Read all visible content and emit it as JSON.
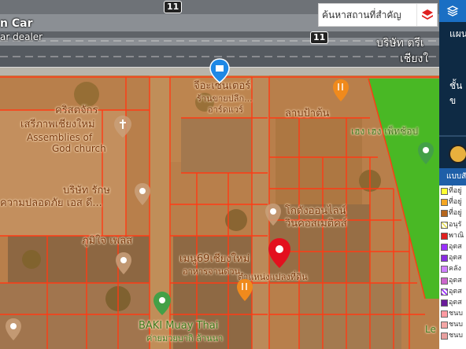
{
  "search": {
    "placeholder": "ค้นหาสถานที่สำคัญ"
  },
  "sidebar": {
    "menu_1": "แผน",
    "menu_2": "ชั้นข"
  },
  "legend": {
    "header": "แบบสัญ",
    "items": [
      {
        "label": "ที่อยู่",
        "color": "#ffff33"
      },
      {
        "label": "ที่อยู่",
        "color": "#f5a623"
      },
      {
        "label": "ที่อยู่",
        "color": "#b5651d"
      },
      {
        "label": "อนุรั",
        "color": "#e8e060",
        "hatched": true
      },
      {
        "label": "พาณิ",
        "color": "#e02020"
      },
      {
        "label": "อุตส",
        "color": "#9b30ff"
      },
      {
        "label": "อุตส",
        "color": "#8a2be2"
      },
      {
        "label": "คลัง",
        "color": "#d080ff"
      },
      {
        "label": "อุตส",
        "color": "#cc66cc"
      },
      {
        "label": "อุตส",
        "color": "#9b30ff",
        "hatched": true
      },
      {
        "label": "อุตส",
        "color": "#6a1b9a"
      },
      {
        "label": "ชนบ",
        "color": "#ff9aa2"
      },
      {
        "label": "ชนบ",
        "color": "#f4a6a6"
      },
      {
        "label": "ชนบ",
        "color": "#e8a0a0"
      }
    ]
  },
  "map": {
    "road_labels": {
      "car_dealer_1": "n Car",
      "car_dealer_2": "ar dealer",
      "company_top_1": "บริษัท ตรีเ",
      "company_top_2": "เชียงใ",
      "highway_1": "11",
      "highway_2": "11"
    },
    "places": [
      {
        "id": "restaurant-center-1",
        "text": "จีอะเซนเตอร์"
      },
      {
        "id": "restaurant-center-2",
        "text": "ร้านขายปลีก..."
      },
      {
        "id": "restaurant-center-3",
        "text": "อาร์ดแวร์"
      },
      {
        "id": "church-1",
        "text": "คริสตจักร"
      },
      {
        "id": "church-2",
        "text": "เสรีภาพเชียงใหม่"
      },
      {
        "id": "church-3",
        "text": "Assemblies of"
      },
      {
        "id": "church-4",
        "text": "God church"
      },
      {
        "id": "lab",
        "text": "ลาบป้าต้น"
      },
      {
        "id": "hengheng",
        "text": "เฮง เฮง เพ็ทช้อป"
      },
      {
        "id": "company-1",
        "text": "บริษัท รักษ"
      },
      {
        "id": "company-2",
        "text": "ความปลอดภัย เอส ดี..."
      },
      {
        "id": "kotang-1",
        "text": "โกดังออนไลน์"
      },
      {
        "id": "kotang-2",
        "text": "วินคอสเมติคส์"
      },
      {
        "id": "pumjai",
        "text": "ภูมิใจ เพลส"
      },
      {
        "id": "menu-1",
        "text": "เมนู69เชียงใหม่"
      },
      {
        "id": "menu-2",
        "text": "อาหารจานด่วน"
      },
      {
        "id": "parcel-point",
        "text": "ตำแหน่งแปลงที่ดิน"
      },
      {
        "id": "baki-1",
        "text": "BAKI Muay Thai"
      },
      {
        "id": "baki-2",
        "text": "ค่ายมวยบากิ ล้านนา"
      },
      {
        "id": "le",
        "text": "Le"
      }
    ]
  },
  "colors": {
    "parcel_line": "#ff3b14",
    "overlay": "#e07a20",
    "green_zone": "#35c21f",
    "pin_red": "#e3101e",
    "pin_orange": "#f08a1c",
    "pin_green": "#43a047",
    "pin_blue": "#1e88e5",
    "sidebar_bg": "#0e2a44",
    "legend_header": "#1e5fa8"
  },
  "icons": [
    "layers-icon",
    "layer-stack-icon",
    "location-pin-icon",
    "restaurant-pin-icon",
    "church-pin-icon",
    "shop-pin-icon"
  ]
}
